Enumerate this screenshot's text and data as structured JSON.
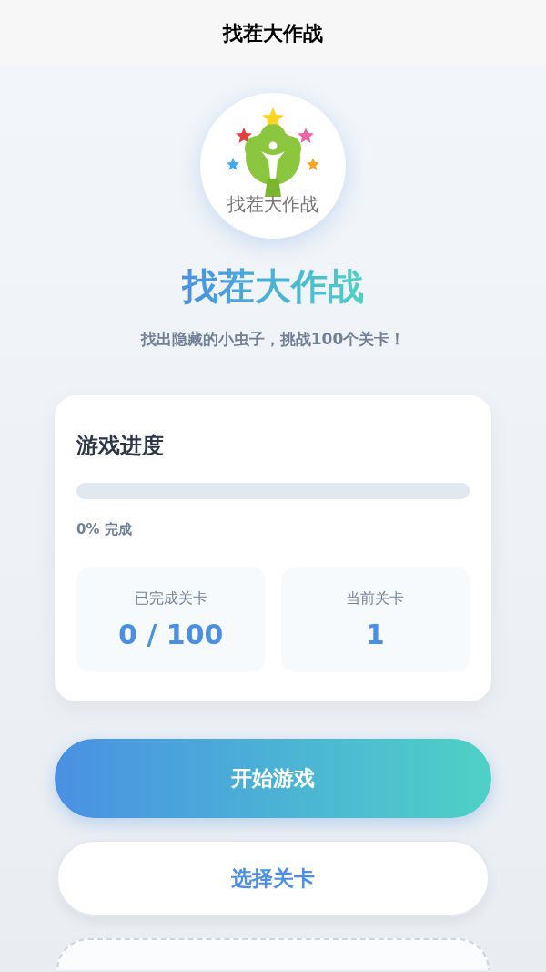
{
  "header": {
    "title": "找茬大作战"
  },
  "logo": {
    "caption": "找茬大作战"
  },
  "hero": {
    "title": "找茬大作战",
    "subtitle": "找出隐藏的小虫子，挑战100个关卡！"
  },
  "progress_card": {
    "title": "游戏进度",
    "level": 0,
    "reading": "0% 完成",
    "stats": [
      {
        "label": "已完成关卡",
        "value": "0 / 100"
      },
      {
        "label": "当前关卡",
        "value": "1"
      }
    ]
  },
  "buttons": [
    {
      "kind": "primary",
      "label": "开始游戏"
    },
    {
      "kind": "secondary",
      "label": "选择关卡"
    },
    {
      "kind": "dashed"
    }
  ]
}
